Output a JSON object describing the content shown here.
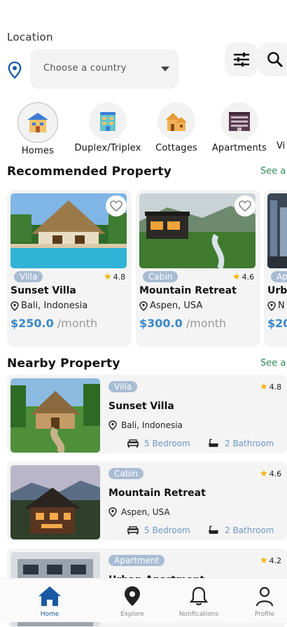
{
  "location": {
    "label": "Location",
    "placeholder": "Choose a country"
  },
  "categories": [
    {
      "label": "Homes",
      "icon": "house-icon"
    },
    {
      "label": "Duplex/Triplex",
      "icon": "building-icon"
    },
    {
      "label": "Cottages",
      "icon": "cottage-icon"
    },
    {
      "label": "Apartments",
      "icon": "apartment-icon"
    },
    {
      "label": "Vi",
      "icon": "villa-icon"
    }
  ],
  "recommended": {
    "title": "Recommended Property",
    "see_all": "See a",
    "items": [
      {
        "tag": "Villa",
        "rating": "4.8",
        "name": "Sunset Villa",
        "location": "Bali, Indonesia",
        "price": "$250.0",
        "per": "/month"
      },
      {
        "tag": "Cabin",
        "rating": "4.6",
        "name": "Mountain Retreat",
        "location": "Aspen, USA",
        "price": "$300.0",
        "per": "/month"
      },
      {
        "tag": "Ap",
        "name": "Urb",
        "location": "N",
        "price": "$20"
      }
    ]
  },
  "nearby": {
    "title": "Nearby Property",
    "see_all": "See a",
    "items": [
      {
        "tag": "Villa",
        "rating": "4.8",
        "name": "Sunset Villa",
        "location": "Bali, Indonesia",
        "bedrooms": "5 Bedroom",
        "bathrooms": "2 Bathroom"
      },
      {
        "tag": "Cabin",
        "rating": "4.6",
        "name": "Mountain Retreat",
        "location": "Aspen, USA",
        "bedrooms": "5 Bedroom",
        "bathrooms": "2 Bathroom"
      },
      {
        "tag": "Apartment",
        "rating": "4.2",
        "name": "Urban Apartment"
      }
    ]
  },
  "nav": [
    {
      "label": "Home",
      "icon": "home-icon",
      "active": true
    },
    {
      "label": "Explore",
      "icon": "map-pin-icon"
    },
    {
      "label": "Notifications",
      "icon": "bell-icon"
    },
    {
      "label": "Profile",
      "icon": "person-icon"
    }
  ],
  "colors": {
    "accent": "#1a5aa3",
    "price": "#3a88c9",
    "see_all": "#2e8b57",
    "tag": "#a8bcd3",
    "star": "#f5b301"
  }
}
